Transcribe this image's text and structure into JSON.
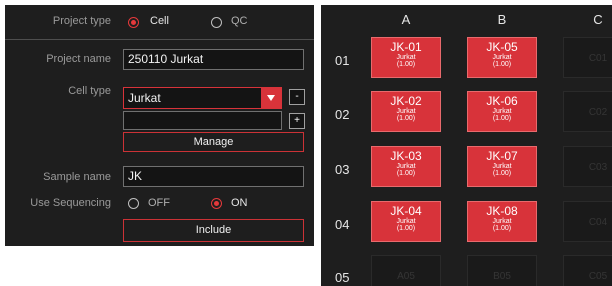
{
  "left_panel": {
    "project_type_label": "Project type",
    "project_type_options": [
      "Cell",
      "QC"
    ],
    "project_name_label": "Project name",
    "project_name_value": "250110 Jurkat",
    "cell_type_label": "Cell type",
    "cell_type_selected": "Jurkat",
    "cell_type_input_value": "",
    "remove_label": "-",
    "add_label": "+",
    "manage_label": "Manage",
    "sample_name_label": "Sample name",
    "sample_name_value": "JK",
    "use_sequencing_label": "Use Sequencing",
    "sequencing_options": [
      "OFF",
      "ON"
    ],
    "include_label": "Include"
  },
  "plate": {
    "columns": [
      "A",
      "B",
      "C"
    ],
    "rows": [
      "01",
      "02",
      "03",
      "04",
      "05"
    ],
    "wells": [
      {
        "id": "JK-01",
        "name": "Jurkat",
        "value": "(1.00)"
      },
      {
        "id": "JK-05",
        "name": "Jurkat",
        "value": "(1.00)"
      },
      {
        "id": "C01",
        "name": "",
        "value": ""
      },
      {
        "id": "JK-02",
        "name": "Jurkat",
        "value": "(1.00)"
      },
      {
        "id": "JK-06",
        "name": "Jurkat",
        "value": "(1.00)"
      },
      {
        "id": "C02",
        "name": "",
        "value": ""
      },
      {
        "id": "JK-03",
        "name": "Jurkat",
        "value": "(1.00)"
      },
      {
        "id": "JK-07",
        "name": "Jurkat",
        "value": "(1.00)"
      },
      {
        "id": "C03",
        "name": "",
        "value": ""
      },
      {
        "id": "JK-04",
        "name": "Jurkat",
        "value": "(1.00)"
      },
      {
        "id": "JK-08",
        "name": "Jurkat",
        "value": "(1.00)"
      },
      {
        "id": "C04",
        "name": "",
        "value": ""
      },
      {
        "id": "A05",
        "name": "",
        "value": ""
      },
      {
        "id": "B05",
        "name": "",
        "value": ""
      },
      {
        "id": "C05",
        "name": "",
        "value": ""
      }
    ]
  },
  "colors": {
    "accent": "#d8333a",
    "panel_bg": "#1e1e1e",
    "field_bg": "#141414"
  }
}
